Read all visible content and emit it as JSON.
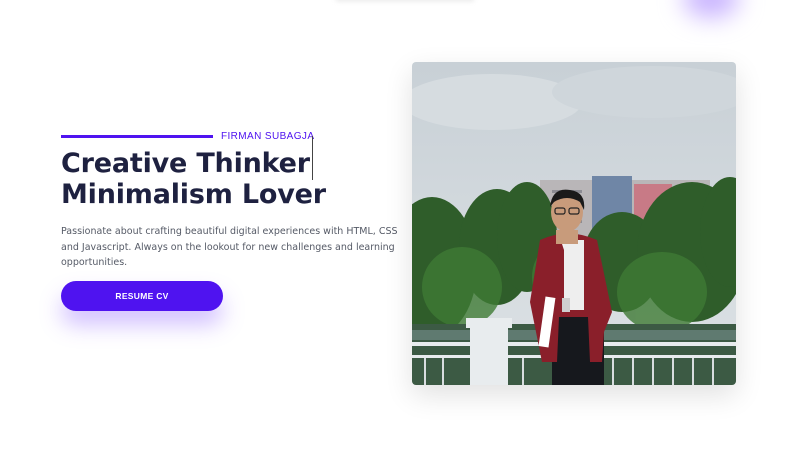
{
  "hero": {
    "subtitle": "FIRMAN SUBAGJA",
    "headline_line1": "Creative Thinker",
    "headline_line2": "Minimalism Lover",
    "description": "Passionate about crafting beautiful digital experiences with HTML, CSS and Javascript. Always on the lookout for new challenges and learning opportunities.",
    "cta_label": "RESUME CV"
  },
  "colors": {
    "accent": "#4f13f0",
    "heading": "#1e2140",
    "body_text": "#555a66"
  }
}
